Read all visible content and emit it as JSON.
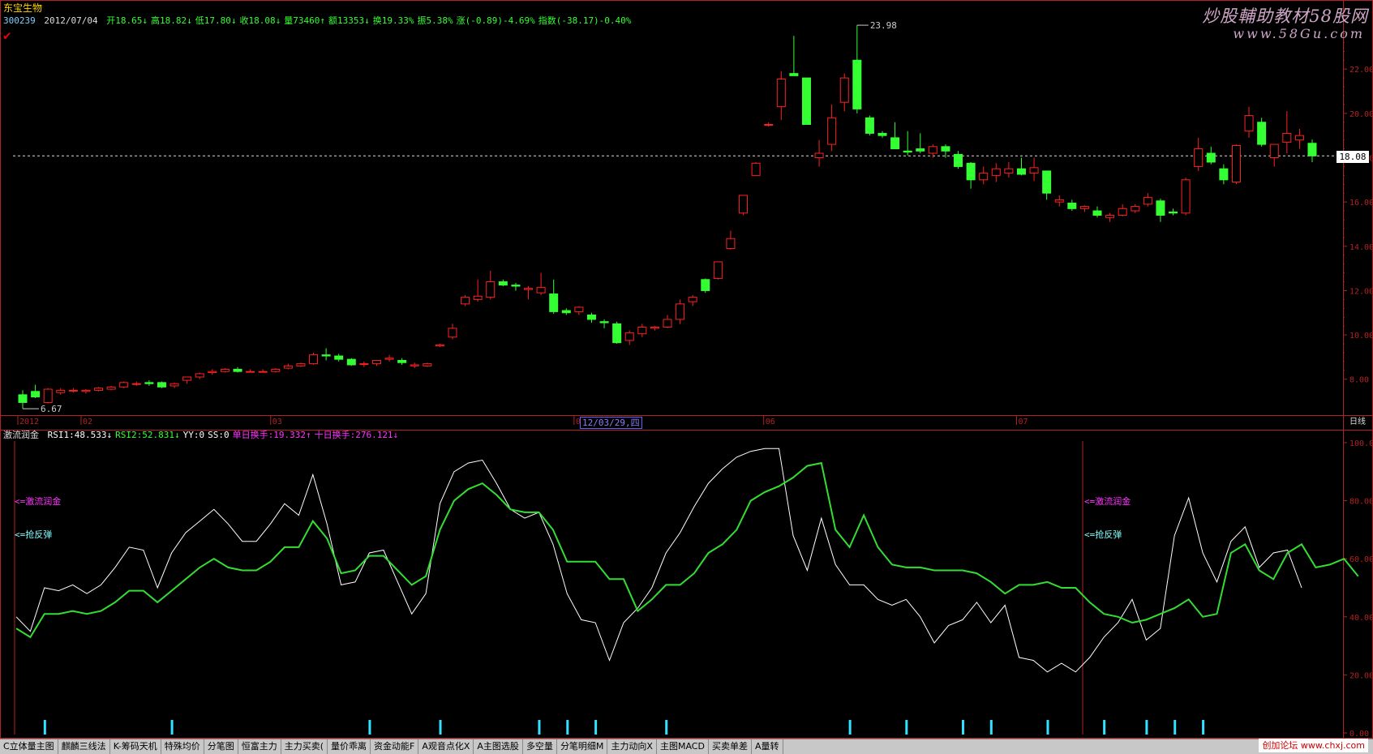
{
  "header": {
    "stock_name": "东宝生物",
    "code": "300239",
    "date": "2012/07/04",
    "fields": [
      {
        "label": "开18.65",
        "arrow": "↓",
        "color": "#33ff33"
      },
      {
        "label": "高18.82",
        "arrow": "↓",
        "color": "#33ff33"
      },
      {
        "label": "低17.80",
        "arrow": "↓",
        "color": "#33ff33"
      },
      {
        "label": "收18.08",
        "arrow": "↓",
        "color": "#33ff33"
      },
      {
        "label": "量73460",
        "arrow": "↑",
        "color": "#33ff33"
      },
      {
        "label": "额13353",
        "arrow": "↓",
        "color": "#33ff33"
      },
      {
        "label": "换19.33%",
        "arrow": "",
        "color": "#33ff33"
      },
      {
        "label": "振5.38%",
        "arrow": "",
        "color": "#33ff33"
      },
      {
        "label": "涨(-0.89)-4.69%",
        "arrow": "",
        "color": "#33ff33"
      },
      {
        "label": "指数(-38.17)-0.40%",
        "arrow": "",
        "color": "#33ff33"
      }
    ],
    "check_mark": "✔"
  },
  "watermark": {
    "title": "炒股輔助教材58股网",
    "url": "www.58Gu.com",
    "bottom": "创加论坛 www.chxj.com"
  },
  "indicator": {
    "name": "激流润金",
    "fields": [
      {
        "text": "RSI1:48.533↓",
        "color": "#ffffff"
      },
      {
        "text": "RSI2:52.831↓",
        "color": "#33ff33"
      },
      {
        "text": "YY:0",
        "color": "#ffffff"
      },
      {
        "text": "SS:0",
        "color": "#ffffff"
      },
      {
        "text": "单日换手:19.332↑",
        "color": "#ff33ff"
      },
      {
        "text": "十日换手:276.121↓",
        "color": "#ff33ff"
      }
    ],
    "signal_labels": [
      "<=激流润金",
      "<=抢反弹"
    ]
  },
  "date_box": "12/03/29,四",
  "tabs": [
    "C立体量主图",
    "麒麟三线法",
    "K-筹码天机",
    "特殊均价",
    "分笔图",
    "恒富主力",
    "主力买卖(",
    "量价乖离",
    "资金动能F",
    "A观音点化X",
    "A主图选股",
    "多空量",
    "分笔明细M",
    "主力动向X",
    "主图MACD",
    "买卖单差",
    "A量转"
  ],
  "colors": {
    "up": "#ff2020",
    "down": "#33ff33",
    "axis": "#b22222",
    "rsi1": "#ffffff",
    "rsi2": "#33dd33",
    "signal": "#7fffff"
  },
  "chart_data": [
    {
      "type": "candlestick",
      "title": "东宝生物 300239 日线",
      "y_ticks": [
        8.0,
        10.0,
        12.0,
        14.0,
        16.0,
        18.0,
        20.0,
        22.0
      ],
      "ylim": [
        6.6,
        23.8
      ],
      "x_tick_labels": [
        {
          "index": 0,
          "label": "2012"
        },
        {
          "index": 5,
          "label": "02"
        },
        {
          "index": 20,
          "label": "03"
        },
        {
          "index": 44,
          "label": "05"
        },
        {
          "index": 59,
          "label": "06"
        },
        {
          "index": 79,
          "label": "07"
        }
      ],
      "period_label": "日线",
      "current_price": 18.08,
      "annotations": [
        {
          "type": "high",
          "value": 23.98
        },
        {
          "type": "low",
          "value": 6.67
        }
      ],
      "candles": [
        {
          "o": 7.3,
          "h": 7.5,
          "l": 6.67,
          "c": 6.95
        },
        {
          "o": 7.45,
          "h": 7.75,
          "l": 7.15,
          "c": 7.2
        },
        {
          "o": 6.95,
          "h": 7.6,
          "l": 6.9,
          "c": 7.55
        },
        {
          "o": 7.4,
          "h": 7.6,
          "l": 7.3,
          "c": 7.5
        },
        {
          "o": 7.5,
          "h": 7.6,
          "l": 7.4,
          "c": 7.5
        },
        {
          "o": 7.45,
          "h": 7.55,
          "l": 7.35,
          "c": 7.5
        },
        {
          "o": 7.5,
          "h": 7.65,
          "l": 7.45,
          "c": 7.6
        },
        {
          "o": 7.55,
          "h": 7.7,
          "l": 7.5,
          "c": 7.65
        },
        {
          "o": 7.65,
          "h": 7.9,
          "l": 7.6,
          "c": 7.85
        },
        {
          "o": 7.8,
          "h": 7.9,
          "l": 7.7,
          "c": 7.8
        },
        {
          "o": 7.85,
          "h": 7.95,
          "l": 7.7,
          "c": 7.8
        },
        {
          "o": 7.85,
          "h": 7.9,
          "l": 7.6,
          "c": 7.65
        },
        {
          "o": 7.7,
          "h": 7.85,
          "l": 7.6,
          "c": 7.8
        },
        {
          "o": 7.95,
          "h": 8.1,
          "l": 7.8,
          "c": 8.1
        },
        {
          "o": 8.1,
          "h": 8.3,
          "l": 8.0,
          "c": 8.25
        },
        {
          "o": 8.3,
          "h": 8.45,
          "l": 8.2,
          "c": 8.35
        },
        {
          "o": 8.35,
          "h": 8.5,
          "l": 8.3,
          "c": 8.45
        },
        {
          "o": 8.45,
          "h": 8.55,
          "l": 8.3,
          "c": 8.35
        },
        {
          "o": 8.35,
          "h": 8.45,
          "l": 8.3,
          "c": 8.35
        },
        {
          "o": 8.35,
          "h": 8.45,
          "l": 8.3,
          "c": 8.35
        },
        {
          "o": 8.35,
          "h": 8.5,
          "l": 8.3,
          "c": 8.45
        },
        {
          "o": 8.5,
          "h": 8.7,
          "l": 8.45,
          "c": 8.6
        },
        {
          "o": 8.6,
          "h": 8.75,
          "l": 8.55,
          "c": 8.7
        },
        {
          "o": 8.7,
          "h": 9.2,
          "l": 8.65,
          "c": 9.1
        },
        {
          "o": 9.1,
          "h": 9.4,
          "l": 8.85,
          "c": 9.05
        },
        {
          "o": 9.05,
          "h": 9.15,
          "l": 8.8,
          "c": 8.9
        },
        {
          "o": 8.9,
          "h": 8.95,
          "l": 8.6,
          "c": 8.65
        },
        {
          "o": 8.7,
          "h": 8.8,
          "l": 8.55,
          "c": 8.7
        },
        {
          "o": 8.7,
          "h": 8.85,
          "l": 8.6,
          "c": 8.85
        },
        {
          "o": 8.9,
          "h": 9.1,
          "l": 8.8,
          "c": 8.95
        },
        {
          "o": 8.85,
          "h": 8.95,
          "l": 8.65,
          "c": 8.75
        },
        {
          "o": 8.6,
          "h": 8.75,
          "l": 8.5,
          "c": 8.65
        },
        {
          "o": 8.6,
          "h": 8.75,
          "l": 8.55,
          "c": 8.7
        },
        {
          "o": 9.5,
          "h": 9.6,
          "l": 9.45,
          "c": 9.55
        },
        {
          "o": 9.9,
          "h": 10.5,
          "l": 9.8,
          "c": 10.3
        },
        {
          "o": 11.4,
          "h": 11.8,
          "l": 11.3,
          "c": 11.7
        },
        {
          "o": 11.6,
          "h": 12.5,
          "l": 11.5,
          "c": 11.75
        },
        {
          "o": 11.7,
          "h": 12.9,
          "l": 11.6,
          "c": 12.4
        },
        {
          "o": 12.4,
          "h": 12.5,
          "l": 12.2,
          "c": 12.25
        },
        {
          "o": 12.25,
          "h": 12.35,
          "l": 12.0,
          "c": 12.2
        },
        {
          "o": 12.05,
          "h": 12.2,
          "l": 11.6,
          "c": 12.1
        },
        {
          "o": 11.9,
          "h": 12.8,
          "l": 11.8,
          "c": 12.15
        },
        {
          "o": 11.85,
          "h": 12.5,
          "l": 10.95,
          "c": 11.05
        },
        {
          "o": 11.1,
          "h": 11.2,
          "l": 10.9,
          "c": 11.0
        },
        {
          "o": 11.05,
          "h": 11.3,
          "l": 10.9,
          "c": 11.25
        },
        {
          "o": 10.9,
          "h": 11.0,
          "l": 10.55,
          "c": 10.7
        },
        {
          "o": 10.6,
          "h": 10.7,
          "l": 10.3,
          "c": 10.55
        },
        {
          "o": 10.5,
          "h": 10.6,
          "l": 9.6,
          "c": 9.65
        },
        {
          "o": 9.75,
          "h": 10.2,
          "l": 9.55,
          "c": 10.1
        },
        {
          "o": 10.05,
          "h": 10.5,
          "l": 9.9,
          "c": 10.35
        },
        {
          "o": 10.3,
          "h": 10.4,
          "l": 10.2,
          "c": 10.35
        },
        {
          "o": 10.35,
          "h": 10.9,
          "l": 10.3,
          "c": 10.7
        },
        {
          "o": 10.7,
          "h": 11.6,
          "l": 10.5,
          "c": 11.4
        },
        {
          "o": 11.5,
          "h": 11.8,
          "l": 11.3,
          "c": 11.7
        },
        {
          "o": 12.5,
          "h": 12.55,
          "l": 11.9,
          "c": 12.0
        },
        {
          "o": 12.55,
          "h": 13.3,
          "l": 12.5,
          "c": 13.3
        },
        {
          "o": 13.9,
          "h": 14.7,
          "l": 13.85,
          "c": 14.35
        },
        {
          "o": 15.5,
          "h": 16.3,
          "l": 15.4,
          "c": 16.3
        },
        {
          "o": 17.2,
          "h": 17.8,
          "l": 17.2,
          "c": 17.75
        },
        {
          "o": 19.5,
          "h": 19.6,
          "l": 19.4,
          "c": 19.5
        },
        {
          "o": 20.3,
          "h": 21.9,
          "l": 19.7,
          "c": 21.55
        },
        {
          "o": 21.8,
          "h": 23.5,
          "l": 21.7,
          "c": 21.7
        },
        {
          "o": 21.6,
          "h": 21.6,
          "l": 19.5,
          "c": 19.5
        },
        {
          "o": 18.0,
          "h": 18.8,
          "l": 17.6,
          "c": 18.2
        },
        {
          "o": 18.6,
          "h": 20.4,
          "l": 18.3,
          "c": 19.8
        },
        {
          "o": 20.5,
          "h": 21.8,
          "l": 20.1,
          "c": 21.6
        },
        {
          "o": 22.4,
          "h": 23.98,
          "l": 20.0,
          "c": 20.2
        },
        {
          "o": 19.8,
          "h": 19.9,
          "l": 19.0,
          "c": 19.1
        },
        {
          "o": 19.1,
          "h": 19.2,
          "l": 18.9,
          "c": 19.0
        },
        {
          "o": 18.9,
          "h": 19.6,
          "l": 18.5,
          "c": 18.4
        },
        {
          "o": 18.3,
          "h": 19.2,
          "l": 18.1,
          "c": 18.25
        },
        {
          "o": 18.4,
          "h": 19.1,
          "l": 18.2,
          "c": 18.3
        },
        {
          "o": 18.2,
          "h": 18.6,
          "l": 18.0,
          "c": 18.5
        },
        {
          "o": 18.5,
          "h": 18.6,
          "l": 18.0,
          "c": 18.3
        },
        {
          "o": 18.15,
          "h": 18.3,
          "l": 17.5,
          "c": 17.6
        },
        {
          "o": 17.75,
          "h": 17.8,
          "l": 16.6,
          "c": 17.0
        },
        {
          "o": 17.0,
          "h": 17.6,
          "l": 16.8,
          "c": 17.3
        },
        {
          "o": 17.2,
          "h": 17.75,
          "l": 16.9,
          "c": 17.5
        },
        {
          "o": 17.3,
          "h": 17.8,
          "l": 17.1,
          "c": 17.5
        },
        {
          "o": 17.5,
          "h": 18.0,
          "l": 17.2,
          "c": 17.25
        },
        {
          "o": 17.3,
          "h": 18.0,
          "l": 16.95,
          "c": 17.55
        },
        {
          "o": 17.4,
          "h": 17.4,
          "l": 16.1,
          "c": 16.4
        },
        {
          "o": 16.0,
          "h": 16.3,
          "l": 15.8,
          "c": 16.1
        },
        {
          "o": 15.95,
          "h": 16.1,
          "l": 15.6,
          "c": 15.7
        },
        {
          "o": 15.7,
          "h": 15.85,
          "l": 15.55,
          "c": 15.8
        },
        {
          "o": 15.6,
          "h": 15.8,
          "l": 15.3,
          "c": 15.4
        },
        {
          "o": 15.3,
          "h": 15.5,
          "l": 15.1,
          "c": 15.4
        },
        {
          "o": 15.4,
          "h": 15.9,
          "l": 15.35,
          "c": 15.7
        },
        {
          "o": 15.6,
          "h": 15.9,
          "l": 15.5,
          "c": 15.8
        },
        {
          "o": 15.9,
          "h": 16.4,
          "l": 15.8,
          "c": 16.2
        },
        {
          "o": 16.05,
          "h": 16.15,
          "l": 15.1,
          "c": 15.4
        },
        {
          "o": 15.55,
          "h": 15.7,
          "l": 15.4,
          "c": 15.5
        },
        {
          "o": 15.5,
          "h": 17.1,
          "l": 15.4,
          "c": 17.0
        },
        {
          "o": 17.6,
          "h": 18.9,
          "l": 17.4,
          "c": 18.4
        },
        {
          "o": 18.2,
          "h": 18.5,
          "l": 17.7,
          "c": 17.8
        },
        {
          "o": 17.5,
          "h": 17.7,
          "l": 16.8,
          "c": 17.0
        },
        {
          "o": 16.9,
          "h": 18.6,
          "l": 16.8,
          "c": 18.55
        },
        {
          "o": 19.2,
          "h": 20.3,
          "l": 18.9,
          "c": 19.9
        },
        {
          "o": 19.6,
          "h": 19.8,
          "l": 18.5,
          "c": 18.6
        },
        {
          "o": 18.0,
          "h": 18.6,
          "l": 17.6,
          "c": 18.6
        },
        {
          "o": 18.7,
          "h": 20.1,
          "l": 18.2,
          "c": 19.1
        },
        {
          "o": 18.8,
          "h": 19.3,
          "l": 18.4,
          "c": 19.0
        },
        {
          "o": 18.65,
          "h": 18.82,
          "l": 17.8,
          "c": 18.08
        }
      ]
    },
    {
      "type": "line",
      "title": "激流润金",
      "y_ticks": [
        0,
        20,
        40,
        60,
        80,
        100
      ],
      "ylim": [
        0,
        100
      ],
      "series": [
        {
          "name": "RSI1",
          "values": [
            40,
            35,
            50,
            49,
            51,
            48,
            51,
            57,
            64,
            63,
            50,
            62,
            69,
            73,
            77,
            72,
            66,
            66,
            72,
            79,
            75,
            89,
            72,
            51,
            52,
            62,
            63,
            52,
            41,
            48,
            79,
            90,
            93,
            94,
            86,
            77,
            74,
            76,
            65,
            48,
            39,
            38,
            25,
            38,
            43,
            50,
            62,
            69,
            78,
            86,
            91,
            95,
            97,
            98,
            98,
            68,
            56,
            74,
            58,
            51,
            51,
            46,
            44,
            46,
            40,
            31,
            37,
            39,
            45,
            38,
            44,
            26,
            25,
            21,
            24,
            21,
            26,
            33,
            38,
            46,
            32,
            36,
            68,
            81,
            62,
            52,
            66,
            71,
            57,
            62,
            63,
            50
          ]
        },
        {
          "name": "RSI2",
          "values": [
            36,
            33,
            41,
            41,
            42,
            41,
            42,
            45,
            49,
            49,
            45,
            49,
            53,
            57,
            60,
            57,
            56,
            56,
            59,
            64,
            64,
            73,
            67,
            55,
            56,
            61,
            61,
            56,
            51,
            54,
            70,
            80,
            84,
            86,
            82,
            77,
            76,
            76,
            70,
            59,
            59,
            59,
            53,
            53,
            42,
            46,
            51,
            51,
            55,
            62,
            65,
            70,
            80,
            83,
            85,
            88,
            92,
            93,
            70,
            64,
            75,
            64,
            58,
            57,
            57,
            56,
            56,
            56,
            55,
            52,
            48,
            51,
            51,
            52,
            50,
            50,
            45,
            41,
            40,
            38,
            39,
            41,
            43,
            46,
            40,
            41,
            62,
            65,
            56,
            53,
            62,
            65,
            57,
            58,
            60,
            54
          ]
        }
      ],
      "signal_bars_at": [
        2,
        11,
        25,
        30,
        37,
        39,
        41,
        46,
        59,
        63,
        67,
        69,
        73,
        77,
        80,
        82,
        84
      ]
    }
  ]
}
